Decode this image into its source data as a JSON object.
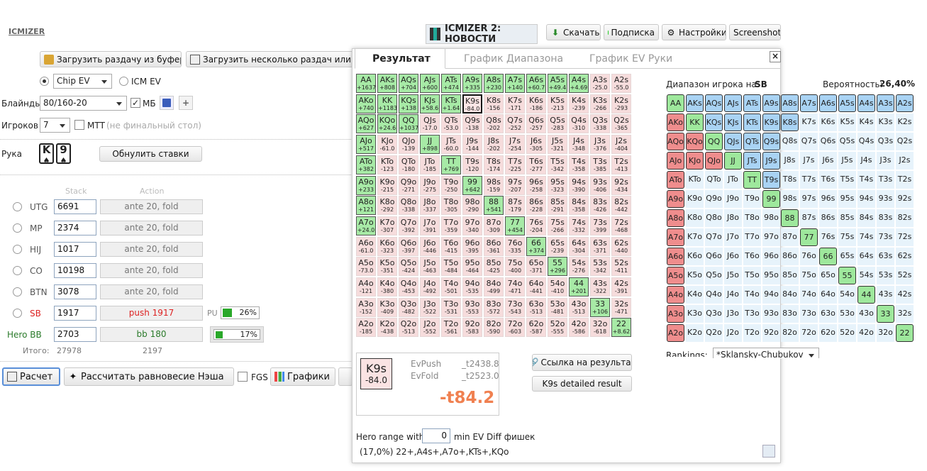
{
  "app": {
    "logo": "ICMIZER",
    "banner": "ICMIZER 2: НОВОСТИ"
  },
  "toolbar": {
    "download": "Скачать",
    "subscribe": "Подписка",
    "settings": "Настройки",
    "screenshot": "Screenshot"
  },
  "left": {
    "load_clip": "Загрузить раздачу из буфера",
    "load_many": "Загрузить несколько раздач или тур",
    "mode_chip": "Chip EV",
    "mode_icm": "ICM EV",
    "blinds_label": "Блайнды",
    "blinds_value": "80/160-20",
    "mb_label": "МБ",
    "players_label": "Игроков",
    "players_value": "7",
    "mtt_label": "МТТ",
    "mtt_hint": "(не финальный стол)",
    "hand_label": "Рука",
    "hand_card1": "K",
    "hand_card2": "9",
    "reset": "Обнулить ставки",
    "stack_header": "Stack",
    "action_header": "Action",
    "players": [
      {
        "pos": "UTG",
        "stack": "6691",
        "action": "ante 20, fold"
      },
      {
        "pos": "MP",
        "stack": "2374",
        "action": "ante 20, fold"
      },
      {
        "pos": "HIJ",
        "stack": "1017",
        "action": "ante 20, fold"
      },
      {
        "pos": "CO",
        "stack": "10198",
        "action": "ante 20, fold"
      },
      {
        "pos": "BTN",
        "stack": "3078",
        "action": "ante 20, fold"
      },
      {
        "pos": "SB",
        "stack": "1917",
        "action": "push 1917",
        "pu_label": "PU",
        "pu_pct": "26%",
        "pu_fraction": 0.26
      },
      {
        "pos": "Hero BB",
        "stack": "2703",
        "action": "bb 180",
        "pct": "17%",
        "fraction": 0.17
      }
    ],
    "total_label": "Итого:",
    "total_stack": "27978",
    "total_action": "2197",
    "calc": "Расчет",
    "nash": "Рассчитать равновесие Нэша",
    "fgs": "FGS",
    "charts": "Графики"
  },
  "result": {
    "tabs": [
      "Результат",
      "График Диапазона",
      "График EV Руки"
    ],
    "close": "×",
    "hand": "K9s",
    "hand_ev": "-84.0",
    "evpush_label": "EvPush",
    "evpush": "_t2438.8",
    "evfold_label": "EvFold",
    "evfold": "_t2523.0",
    "diff": "-t84.2",
    "link": "Ссылка на результат",
    "detailed": "K9s detailed result",
    "hero_range_label": "Hero range with",
    "hero_range_value": "0",
    "hero_range_suffix": "min EV Diff фишек",
    "range_text": "(17,0%) 22+,A4s+,A7o+,KTs+,KQo"
  },
  "matrix": [
    [
      [
        "AA",
        "+1637",
        1
      ],
      [
        "AKs",
        "+808",
        1
      ],
      [
        "AQs",
        "+704",
        1
      ],
      [
        "AJs",
        "+600",
        1
      ],
      [
        "ATs",
        "+474",
        1
      ],
      [
        "A9s",
        "+335",
        1
      ],
      [
        "A8s",
        "+230",
        1
      ],
      [
        "A7s",
        "+140",
        1
      ],
      [
        "A6s",
        "+60.7",
        1
      ],
      [
        "A5s",
        "+49.4",
        1
      ],
      [
        "A4s",
        "+4.69",
        1
      ],
      [
        "A3s",
        "-25.0",
        0
      ],
      [
        "A2s",
        "-55.0",
        0
      ]
    ],
    [
      [
        "AKo",
        "+740",
        1
      ],
      [
        "KK",
        "+1183",
        1
      ],
      [
        "KQs",
        "+138",
        1
      ],
      [
        "KJs",
        "+58.6",
        1
      ],
      [
        "KTs",
        "+1.64",
        1
      ],
      [
        "K9s",
        "-84.0",
        2
      ],
      [
        "K8s",
        "-156",
        0
      ],
      [
        "K7s",
        "-171",
        0
      ],
      [
        "K6s",
        "-186",
        0
      ],
      [
        "K5s",
        "-213",
        0
      ],
      [
        "K4s",
        "-239",
        0
      ],
      [
        "K3s",
        "-266",
        0
      ],
      [
        "K2s",
        "-293",
        0
      ]
    ],
    [
      [
        "AQo",
        "+627",
        1
      ],
      [
        "KQo",
        "+24.6",
        1
      ],
      [
        "QQ",
        "+1037",
        1
      ],
      [
        "QJs",
        "-17.0",
        0
      ],
      [
        "QTs",
        "-53.0",
        0
      ],
      [
        "Q9s",
        "-138",
        0
      ],
      [
        "Q8s",
        "-202",
        0
      ],
      [
        "Q7s",
        "-252",
        0
      ],
      [
        "Q6s",
        "-257",
        0
      ],
      [
        "Q5s",
        "-283",
        0
      ],
      [
        "Q4s",
        "-310",
        0
      ],
      [
        "Q3s",
        "-338",
        0
      ],
      [
        "Q2s",
        "-365",
        0
      ]
    ],
    [
      [
        "AJo",
        "+517",
        1
      ],
      [
        "KJo",
        "-61.0",
        0
      ],
      [
        "QJo",
        "-139",
        0
      ],
      [
        "JJ",
        "+898",
        1
      ],
      [
        "JTs",
        "-60.0",
        0
      ],
      [
        "J9s",
        "-144",
        0
      ],
      [
        "J8s",
        "-202",
        0
      ],
      [
        "J7s",
        "-254",
        0
      ],
      [
        "J6s",
        "-305",
        0
      ],
      [
        "J5s",
        "-321",
        0
      ],
      [
        "J4s",
        "-348",
        0
      ],
      [
        "J3s",
        "-376",
        0
      ],
      [
        "J2s",
        "-404",
        0
      ]
    ],
    [
      [
        "ATo",
        "+382",
        1
      ],
      [
        "KTo",
        "-123",
        0
      ],
      [
        "QTo",
        "-180",
        0
      ],
      [
        "JTo",
        "-185",
        0
      ],
      [
        "TT",
        "+769",
        1
      ],
      [
        "T9s",
        "-120",
        0
      ],
      [
        "T8s",
        "-174",
        0
      ],
      [
        "T7s",
        "-225",
        0
      ],
      [
        "T6s",
        "-277",
        0
      ],
      [
        "T5s",
        "-342",
        0
      ],
      [
        "T4s",
        "-358",
        0
      ],
      [
        "T3s",
        "-385",
        0
      ],
      [
        "T2s",
        "-413",
        0
      ]
    ],
    [
      [
        "A9o",
        "+233",
        1
      ],
      [
        "K9o",
        "-215",
        0
      ],
      [
        "Q9o",
        "-271",
        0
      ],
      [
        "J9o",
        "-275",
        0
      ],
      [
        "T9o",
        "-250",
        0
      ],
      [
        "99",
        "+642",
        1
      ],
      [
        "98s",
        "-159",
        0
      ],
      [
        "97s",
        "-207",
        0
      ],
      [
        "96s",
        "-258",
        0
      ],
      [
        "95s",
        "-323",
        0
      ],
      [
        "94s",
        "-390",
        0
      ],
      [
        "93s",
        "-406",
        0
      ],
      [
        "92s",
        "-434",
        0
      ]
    ],
    [
      [
        "A8o",
        "+121",
        1
      ],
      [
        "K8o",
        "-292",
        0
      ],
      [
        "Q8o",
        "-338",
        0
      ],
      [
        "J8o",
        "-337",
        0
      ],
      [
        "T8o",
        "-305",
        0
      ],
      [
        "98o",
        "-290",
        0
      ],
      [
        "88",
        "+541",
        1
      ],
      [
        "87s",
        "-179",
        0
      ],
      [
        "86s",
        "-228",
        0
      ],
      [
        "85s",
        "-291",
        0
      ],
      [
        "84s",
        "-358",
        0
      ],
      [
        "83s",
        "-426",
        0
      ],
      [
        "82s",
        "-442",
        0
      ]
    ],
    [
      [
        "A7o",
        "+24.0",
        1
      ],
      [
        "K7o",
        "-307",
        0
      ],
      [
        "Q7o",
        "-392",
        0
      ],
      [
        "J7o",
        "-391",
        0
      ],
      [
        "T7o",
        "-359",
        0
      ],
      [
        "97o",
        "-340",
        0
      ],
      [
        "87o",
        "-309",
        0
      ],
      [
        "77",
        "+454",
        1
      ],
      [
        "76s",
        "-204",
        0
      ],
      [
        "75s",
        "-266",
        0
      ],
      [
        "74s",
        "-332",
        0
      ],
      [
        "73s",
        "-399",
        0
      ],
      [
        "72s",
        "-468",
        0
      ]
    ],
    [
      [
        "A6o",
        "-61.0",
        0
      ],
      [
        "K6o",
        "-323",
        0
      ],
      [
        "Q6o",
        "-397",
        0
      ],
      [
        "J6o",
        "-446",
        0
      ],
      [
        "T6o",
        "-415",
        0
      ],
      [
        "96o",
        "-395",
        0
      ],
      [
        "86o",
        "-361",
        0
      ],
      [
        "76o",
        "-335",
        0
      ],
      [
        "66",
        "+374",
        1
      ],
      [
        "65s",
        "-239",
        0
      ],
      [
        "64s",
        "-304",
        0
      ],
      [
        "63s",
        "-371",
        0
      ],
      [
        "62s",
        "-440",
        0
      ]
    ],
    [
      [
        "A5o",
        "-73.0",
        0
      ],
      [
        "K5o",
        "-351",
        0
      ],
      [
        "Q5o",
        "-424",
        0
      ],
      [
        "J5o",
        "-463",
        0
      ],
      [
        "T5o",
        "-484",
        0
      ],
      [
        "95o",
        "-464",
        0
      ],
      [
        "85o",
        "-425",
        0
      ],
      [
        "75o",
        "-400",
        0
      ],
      [
        "65o",
        "-371",
        0
      ],
      [
        "55",
        "+296",
        1
      ],
      [
        "54s",
        "-276",
        0
      ],
      [
        "53s",
        "-342",
        0
      ],
      [
        "52s",
        "-411",
        0
      ]
    ],
    [
      [
        "A4o",
        "-121",
        0
      ],
      [
        "K4o",
        "-380",
        0
      ],
      [
        "Q4o",
        "-453",
        0
      ],
      [
        "J4o",
        "-492",
        0
      ],
      [
        "T4o",
        "-501",
        0
      ],
      [
        "94o",
        "-535",
        0
      ],
      [
        "84o",
        "-499",
        0
      ],
      [
        "74o",
        "-471",
        0
      ],
      [
        "64o",
        "-441",
        0
      ],
      [
        "54o",
        "-410",
        0
      ],
      [
        "44",
        "+201",
        1
      ],
      [
        "43s",
        "-322",
        0
      ],
      [
        "42s",
        "-391",
        0
      ]
    ],
    [
      [
        "A3o",
        "-152",
        0
      ],
      [
        "K3o",
        "-409",
        0
      ],
      [
        "Q3o",
        "-482",
        0
      ],
      [
        "J3o",
        "-522",
        0
      ],
      [
        "T3o",
        "-531",
        0
      ],
      [
        "93o",
        "-553",
        0
      ],
      [
        "83o",
        "-572",
        0
      ],
      [
        "73o",
        "-543",
        0
      ],
      [
        "63o",
        "-513",
        0
      ],
      [
        "53o",
        "-481",
        0
      ],
      [
        "43o",
        "-513",
        0
      ],
      [
        "33",
        "+106",
        1
      ],
      [
        "32s",
        "-471",
        0
      ]
    ],
    [
      [
        "A2o",
        "-185",
        0
      ],
      [
        "K2o",
        "-438",
        0
      ],
      [
        "Q2o",
        "-513",
        0
      ],
      [
        "J2o",
        "-552",
        0
      ],
      [
        "T2o",
        "-561",
        0
      ],
      [
        "92o",
        "-583",
        0
      ],
      [
        "82o",
        "-590",
        0
      ],
      [
        "72o",
        "-603",
        0
      ],
      [
        "62o",
        "-587",
        0
      ],
      [
        "52o",
        "-555",
        0
      ],
      [
        "42o",
        "-586",
        0
      ],
      [
        "32o",
        "-618",
        0
      ],
      [
        "22",
        "+8.62",
        1
      ]
    ]
  ],
  "range_panel": {
    "title": "Диапазон игрока на:",
    "player": "SB",
    "prob_label": "Вероятность:",
    "prob": "26,40%",
    "rankings_label": "Rankings:",
    "rankings_value": "*Sklansky-Chubukov",
    "rows": [
      [
        "AA:g",
        "AKs:b",
        "AQs:b",
        "AJs:b",
        "ATs:b",
        "A9s:b",
        "A8s:b",
        "A7s:b",
        "A6s:b",
        "A5s:b",
        "A4s:b",
        "A3s:b",
        "A2s:b"
      ],
      [
        "AKo:r",
        "KK:g",
        "KQs:b",
        "KJs:b",
        "KTs:b",
        "K9s:b",
        "K8s:b",
        "K7s:l",
        "K6s:l",
        "K5s:l",
        "K4s:l",
        "K3s:l",
        "K2s:l"
      ],
      [
        "AQo:r",
        "KQo:r",
        "QQ:g",
        "QJs:b",
        "QTs:b",
        "Q9s:b",
        "Q8s:l",
        "Q7s:l",
        "Q6s:l",
        "Q5s:l",
        "Q4s:l",
        "Q3s:l",
        "Q2s:l"
      ],
      [
        "AJo:r",
        "KJo:r",
        "QJo:r",
        "JJ:g",
        "JTs:b",
        "J9s:b",
        "J8s:l",
        "J7s:l",
        "J6s:l",
        "J5s:l",
        "J4s:l",
        "J3s:l",
        "J2s:l"
      ],
      [
        "ATo:r",
        "KTo:l",
        "QTo:l",
        "JTo:l",
        "TT:g",
        "T9s:b",
        "T8s:l",
        "T7s:l",
        "T6s:l",
        "T5s:l",
        "T4s:l",
        "T3s:l",
        "T2s:l"
      ],
      [
        "A9o:r",
        "K9o:l",
        "Q9o:l",
        "J9o:l",
        "T9o:l",
        "99:g",
        "98s:l",
        "97s:l",
        "96s:l",
        "95s:l",
        "94s:l",
        "93s:l",
        "92s:l"
      ],
      [
        "A8o:r",
        "K8o:l",
        "Q8o:l",
        "J8o:l",
        "T8o:l",
        "98o:l",
        "88:g",
        "87s:l",
        "86s:l",
        "85s:l",
        "84s:l",
        "83s:l",
        "82s:l"
      ],
      [
        "A7o:r",
        "K7o:l",
        "Q7o:l",
        "J7o:l",
        "T7o:l",
        "97o:l",
        "87o:l",
        "77:g",
        "76s:l",
        "75s:l",
        "74s:l",
        "73s:l",
        "72s:l"
      ],
      [
        "A6o:r",
        "K6o:l",
        "Q6o:l",
        "J6o:l",
        "T6o:l",
        "96o:l",
        "86o:l",
        "76o:l",
        "66:g",
        "65s:l",
        "64s:l",
        "63s:l",
        "62s:l"
      ],
      [
        "A5o:r",
        "K5o:l",
        "Q5o:l",
        "J5o:l",
        "T5o:l",
        "95o:l",
        "85o:l",
        "75o:l",
        "65o:l",
        "55:g",
        "54s:l",
        "53s:l",
        "52s:l"
      ],
      [
        "A4o:r",
        "K4o:l",
        "Q4o:l",
        "J4o:l",
        "T4o:l",
        "94o:l",
        "84o:l",
        "74o:l",
        "64o:l",
        "54o:l",
        "44:g",
        "43s:l",
        "42s:l"
      ],
      [
        "A3o:r",
        "K3o:l",
        "Q3o:l",
        "J3o:l",
        "T3o:l",
        "93o:l",
        "83o:l",
        "73o:l",
        "63o:l",
        "53o:l",
        "43o:l",
        "33:g",
        "32s:l"
      ],
      [
        "A2o:r",
        "K2o:l",
        "Q2o:l",
        "J2o:l",
        "T2o:l",
        "92o:l",
        "82o:l",
        "72o:l",
        "62o:l",
        "52o:l",
        "42o:l",
        "32o:l",
        "22:g"
      ]
    ]
  },
  "colors": {
    "push": "#a7eaa6",
    "fold": "#f6dcdc",
    "diff": "#f08050",
    "range_green": "#9ee89c",
    "range_blue": "#a9d3f4",
    "range_red": "#ef8d8d"
  }
}
